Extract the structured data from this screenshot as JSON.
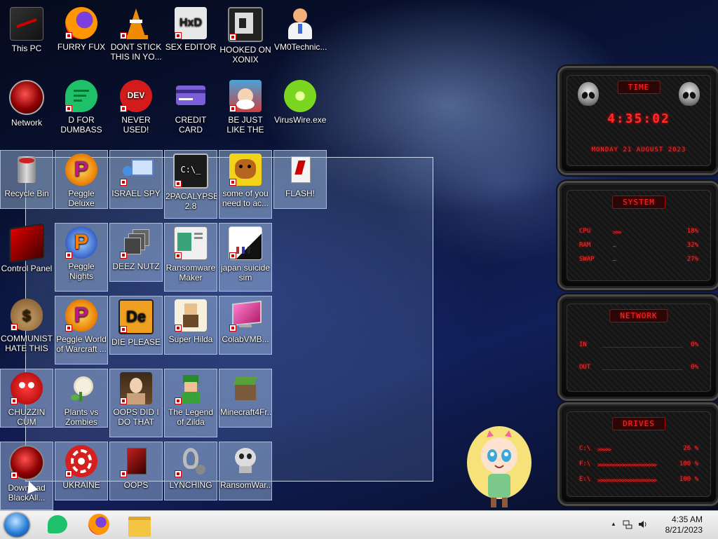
{
  "desktop": {
    "icons": [
      {
        "id": "this-pc",
        "label": "This PC"
      },
      {
        "id": "furry-fux",
        "label": "FURRY FUX"
      },
      {
        "id": "dont-stick",
        "label": "DONT STICK THIS IN YO..."
      },
      {
        "id": "sex-editor",
        "label": "SEX EDITOR"
      },
      {
        "id": "hooked-on-xonix",
        "label": "HOOKED ON XONIX"
      },
      {
        "id": "vm0technic",
        "label": "VM0Technic..."
      },
      {
        "id": "network",
        "label": "Network"
      },
      {
        "id": "d-for-dumbass",
        "label": "D FOR DUMBASS"
      },
      {
        "id": "never-used",
        "label": "NEVER USED!"
      },
      {
        "id": "credit-card-checker",
        "label": "CREDIT CARD CHECKER"
      },
      {
        "id": "be-just-like",
        "label": "BE JUST LIKE THE DUDE!"
      },
      {
        "id": "viruswire",
        "label": "VirusWire.exe"
      },
      {
        "id": "recycle-bin",
        "label": "Recycle Bin"
      },
      {
        "id": "peggle-deluxe",
        "label": "Peggle Deluxe"
      },
      {
        "id": "israel-spy",
        "label": "ISRAEL SPY"
      },
      {
        "id": "2pacalypse",
        "label": "2PACALYPSE 2.8"
      },
      {
        "id": "some-of-you",
        "label": "some of you need to ac..."
      },
      {
        "id": "flash",
        "label": "FLASH!"
      },
      {
        "id": "control-panel",
        "label": "Control Panel"
      },
      {
        "id": "peggle-nights",
        "label": "Peggle Nights Deluxe"
      },
      {
        "id": "deez-nutz",
        "label": "DEEZ NUTZ"
      },
      {
        "id": "ransomware-maker",
        "label": "Ransomware Maker Build..."
      },
      {
        "id": "japan-suicide",
        "label": "japan suicide sim"
      },
      {
        "id": "communists",
        "label": "COMMUNISTS HATE THIS G..."
      },
      {
        "id": "peggle-wow",
        "label": "Peggle World of Warcraft ..."
      },
      {
        "id": "die-please",
        "label": "DIE PLEASE"
      },
      {
        "id": "super-hilda",
        "label": "Super Hilda"
      },
      {
        "id": "colabvmb",
        "label": "ColabVMB..."
      },
      {
        "id": "chuzzin-cum",
        "label": "CHUZZIN CUM"
      },
      {
        "id": "pvz",
        "label": "Plants vs Zombies"
      },
      {
        "id": "oops-did",
        "label": "OOPS DID I DO THAT"
      },
      {
        "id": "zelda",
        "label": "The Legend of Zilda"
      },
      {
        "id": "minecraft",
        "label": "Minecraft4Fr..."
      },
      {
        "id": "download-black",
        "label": "Download BlackAll..."
      },
      {
        "id": "ukraine",
        "label": "UKRAINE"
      },
      {
        "id": "oops",
        "label": "OOPS"
      },
      {
        "id": "lynching",
        "label": "LYNCHING"
      },
      {
        "id": "ransomwar",
        "label": "RansomWar..."
      }
    ]
  },
  "gadgets": {
    "time": {
      "title": "TIME",
      "clock": "4:35:02",
      "date": "MONDAY 21 AUGUST 2023"
    },
    "system": {
      "title": "SYSTEM",
      "rows": [
        {
          "label": "CPU",
          "bar": ">>>",
          "value": "18%"
        },
        {
          "label": "RAM",
          "bar": "—",
          "value": "32%"
        },
        {
          "label": "SWAP",
          "bar": "—",
          "value": "27%"
        }
      ]
    },
    "network": {
      "title": "NETWORK",
      "rows": [
        {
          "label": "IN",
          "value": "0%"
        },
        {
          "label": "OUT",
          "value": "0%"
        }
      ]
    },
    "drives": {
      "title": "DRIVES",
      "rows": [
        {
          "label": "C:\\",
          "bar": ">>>>>",
          "value": "26 %"
        },
        {
          "label": "F:\\",
          "bar": ">>>>>>>>>>>>>>>>>>>>>>",
          "value": "100 %"
        },
        {
          "label": "E:\\",
          "bar": ">>>>>>>>>>>>>>>>>>>>>>",
          "value": "100 %"
        }
      ]
    }
  },
  "taskbar": {
    "tray_time": "4:35 AM",
    "tray_date": "8/21/2023",
    "tray_chevron": "▲"
  },
  "colors": {
    "accent_red": "#ff2a2a",
    "taskbar": "#e6e6e6"
  }
}
